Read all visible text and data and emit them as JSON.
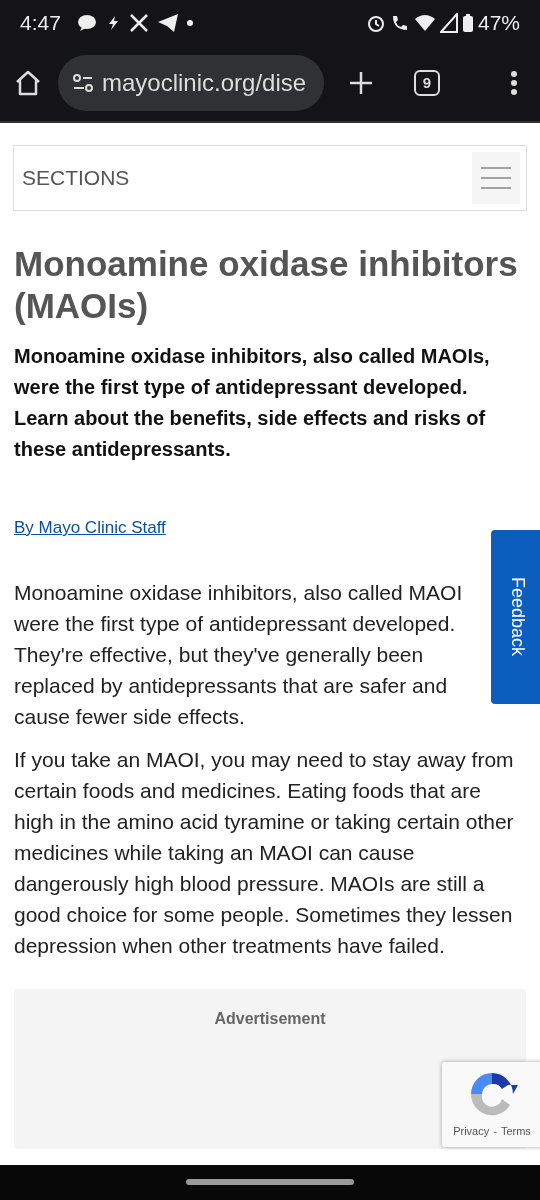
{
  "status_bar": {
    "time": "4:47",
    "battery": "47%"
  },
  "browser": {
    "url": "mayoclinic.org/dise",
    "tab_count": "9"
  },
  "sections_bar": {
    "label": "SECTIONS"
  },
  "article": {
    "title": "Monoamine oxidase inhibitors (MAOIs)",
    "summary": "Monoamine oxidase inhibitors, also called MAOIs, were the first type of antidepressant developed. Learn about the benefits, side effects and risks of these antidepressants.",
    "byline": "By Mayo Clinic Staff",
    "paragraphs": [
      "Monoamine oxidase inhibitors, also called MAOI were the first type of antidepressant developed. They're effective, but they've generally been replaced by antidepressants that are safer and cause fewer side effects.",
      "If you take an MAOI, you may need to stay away from certain foods and medicines. Eating foods that are high in the amino acid tyramine or taking certain other medicines while taking an MAOI can cause dangerously high blood pressure. MAOIs are still a good choice for some people. Sometimes they lessen depression when other treatments have failed."
    ]
  },
  "advertisement": {
    "label": "Advertisement"
  },
  "feedback": {
    "label": "Feedback"
  },
  "recaptcha": {
    "privacy": "Privacy",
    "separator": "-",
    "terms": "Terms"
  }
}
